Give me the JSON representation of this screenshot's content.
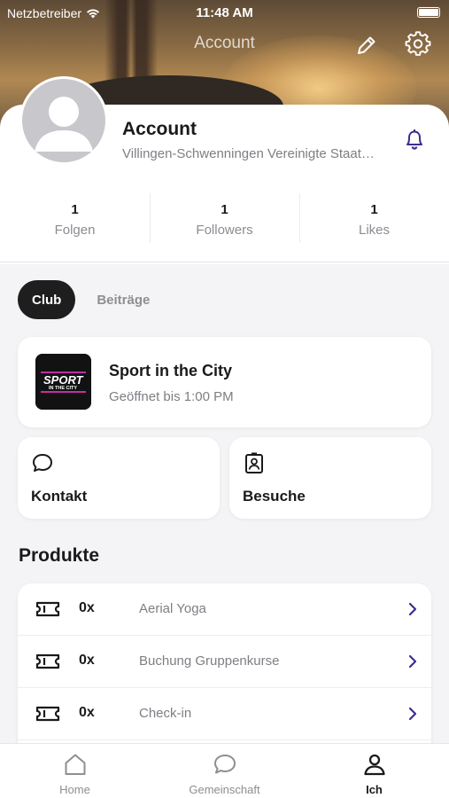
{
  "status_bar": {
    "carrier": "Netzbetreiber",
    "time": "11:48 AM"
  },
  "header": {
    "title": "Account"
  },
  "profile": {
    "name": "Account",
    "location": "Villingen-Schwenningen Vereinigte Staaten",
    "stats": [
      {
        "value": "1",
        "label": "Folgen"
      },
      {
        "value": "1",
        "label": "Followers"
      },
      {
        "value": "1",
        "label": "Likes"
      }
    ]
  },
  "tabs": [
    {
      "label": "Club",
      "active": true
    },
    {
      "label": "Beiträge",
      "active": false
    }
  ],
  "club": {
    "name": "Sport in the City",
    "hours": "Geöffnet bis 1:00 PM",
    "logo_text_main": "SPORT",
    "logo_text_sub": "IN THE CITY"
  },
  "actions": [
    {
      "label": "Kontakt",
      "icon": "chat-bubble-icon"
    },
    {
      "label": "Besuche",
      "icon": "id-badge-icon"
    }
  ],
  "products_section": {
    "title": "Produkte",
    "items": [
      {
        "qty": "0x",
        "name": "Aerial Yoga"
      },
      {
        "qty": "0x",
        "name": "Buchung Gruppenkurse"
      },
      {
        "qty": "0x",
        "name": "Check-in"
      }
    ]
  },
  "tabbar": {
    "items": [
      {
        "label": "Home",
        "icon": "home-icon",
        "active": false
      },
      {
        "label": "Gemeinschaft",
        "icon": "chat-bubble-icon",
        "active": false
      },
      {
        "label": "Ich",
        "icon": "person-icon",
        "active": true
      }
    ]
  },
  "colors": {
    "accent": "#3a2f8f",
    "active_tab": "#1e1e1e",
    "text_secondary": "#7e7e84"
  }
}
